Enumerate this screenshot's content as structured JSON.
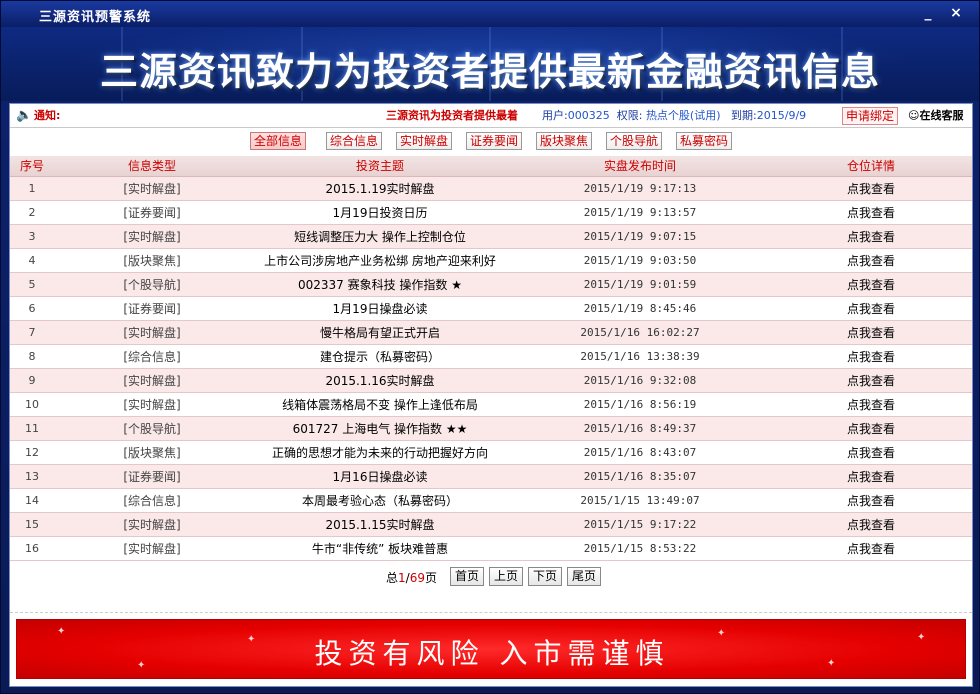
{
  "window": {
    "title": "三源资讯预警系统",
    "minimize_label": "_",
    "close_label": "×"
  },
  "banner": {
    "headline": "三源资讯致力为投资者提供最新金融资讯信息"
  },
  "notice": {
    "label": "通知:",
    "marquee_text": "三源资讯为投资者提供最着",
    "user_label": "用户:",
    "user_id": "000325",
    "perm_label": "权限:",
    "perm_value": "热点个股(试用)",
    "expire_label": "到期:",
    "expire_date": "2015/9/9",
    "bind_button": "申请绑定",
    "service_label": "在线客服"
  },
  "filters": [
    {
      "label": "全部信息",
      "active": true
    },
    {
      "label": "综合信息",
      "active": false
    },
    {
      "label": "实时解盘",
      "active": false
    },
    {
      "label": "证券要闻",
      "active": false
    },
    {
      "label": "版块聚焦",
      "active": false
    },
    {
      "label": "个股导航",
      "active": false
    },
    {
      "label": "私募密码",
      "active": false
    }
  ],
  "table": {
    "headers": [
      "序号",
      "信息类型",
      "投资主题",
      "实盘发布时间",
      "仓位详情"
    ],
    "rows": [
      {
        "idx": "1",
        "type": "[实时解盘]",
        "subject": "2015.1.19实时解盘",
        "time": "2015/1/19 9:17:13",
        "detail": "点我查看"
      },
      {
        "idx": "2",
        "type": "[证券要闻]",
        "subject": "1月19日投资日历",
        "time": "2015/1/19 9:13:57",
        "detail": "点我查看"
      },
      {
        "idx": "3",
        "type": "[实时解盘]",
        "subject": "短线调整压力大 操作上控制仓位",
        "time": "2015/1/19 9:07:15",
        "detail": "点我查看"
      },
      {
        "idx": "4",
        "type": "[版块聚焦]",
        "subject": "上市公司涉房地产业务松绑 房地产迎来利好",
        "time": "2015/1/19 9:03:50",
        "detail": "点我查看"
      },
      {
        "idx": "5",
        "type": "[个股导航]",
        "subject": "002337 赛象科技 操作指数 ★",
        "time": "2015/1/19 9:01:59",
        "detail": "点我查看"
      },
      {
        "idx": "6",
        "type": "[证券要闻]",
        "subject": "1月19日操盘必读",
        "time": "2015/1/19 8:45:46",
        "detail": "点我查看"
      },
      {
        "idx": "7",
        "type": "[实时解盘]",
        "subject": "慢牛格局有望正式开启",
        "time": "2015/1/16 16:02:27",
        "detail": "点我查看"
      },
      {
        "idx": "8",
        "type": "[综合信息]",
        "subject": "建仓提示（私募密码）",
        "time": "2015/1/16 13:38:39",
        "detail": "点我查看"
      },
      {
        "idx": "9",
        "type": "[实时解盘]",
        "subject": "2015.1.16实时解盘",
        "time": "2015/1/16 9:32:08",
        "detail": "点我查看"
      },
      {
        "idx": "10",
        "type": "[实时解盘]",
        "subject": "线箱体震荡格局不变 操作上逢低布局",
        "time": "2015/1/16 8:56:19",
        "detail": "点我查看"
      },
      {
        "idx": "11",
        "type": "[个股导航]",
        "subject": "601727 上海电气 操作指数 ★★",
        "time": "2015/1/16 8:49:37",
        "detail": "点我查看"
      },
      {
        "idx": "12",
        "type": "[版块聚焦]",
        "subject": "正确的思想才能为未来的行动把握好方向",
        "time": "2015/1/16 8:43:07",
        "detail": "点我查看"
      },
      {
        "idx": "13",
        "type": "[证券要闻]",
        "subject": "1月16日操盘必读",
        "time": "2015/1/16 8:35:07",
        "detail": "点我查看"
      },
      {
        "idx": "14",
        "type": "[综合信息]",
        "subject": "本周最考验心态（私募密码）",
        "time": "2015/1/15 13:49:07",
        "detail": "点我查看"
      },
      {
        "idx": "15",
        "type": "[实时解盘]",
        "subject": "2015.1.15实时解盘",
        "time": "2015/1/15 9:17:22",
        "detail": "点我查看"
      },
      {
        "idx": "16",
        "type": "[实时解盘]",
        "subject": "牛市“非传统” 板块难普惠",
        "time": "2015/1/15 8:53:22",
        "detail": "点我查看"
      }
    ]
  },
  "pager": {
    "total_prefix": "总",
    "current_page": "1",
    "separator": "/",
    "total_pages": "69",
    "page_suffix": "页",
    "first": "首页",
    "prev": "上页",
    "next": "下页",
    "last": "尾页"
  },
  "risk_banner": {
    "text": "投资有风险  入市需谨慎"
  },
  "colors": {
    "accent_red": "#cc0000",
    "window_blue": "#0d2270",
    "row_pink": "#fbe9e9",
    "risk_red": "#e50000"
  }
}
